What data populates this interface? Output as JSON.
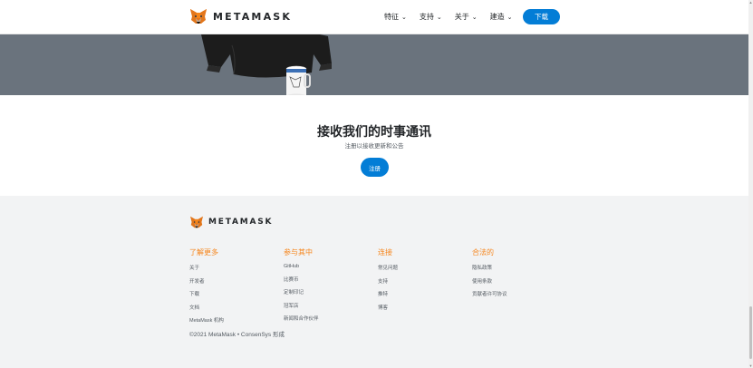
{
  "nav": {
    "brand_name": "METAMASK",
    "items": [
      {
        "label": "特征",
        "icon": "chevron-down-icon"
      },
      {
        "label": "支持",
        "icon": "chevron-down-icon"
      },
      {
        "label": "关于",
        "icon": "chevron-down-icon"
      },
      {
        "label": "建造",
        "icon": "chevron-down-icon"
      }
    ],
    "download_label": "下载"
  },
  "hero": {
    "background_color": "#6a737d",
    "image": "metamask-merch-hoodie-and-mug"
  },
  "newsletter": {
    "title": "接收我们的时事通讯",
    "subtitle": "注册以接收更新和公告",
    "signup_label": "注册"
  },
  "footer": {
    "brand_name": "METAMASK",
    "columns": [
      {
        "heading": "了解更多",
        "links": [
          "关于",
          "开发者",
          "下载",
          "文档",
          "MetaMask 机构"
        ]
      },
      {
        "heading": "参与其中",
        "links": [
          "GitHub",
          "比赛币",
          "定制印记",
          "冠军店",
          "新闻和合作伙伴"
        ]
      },
      {
        "heading": "连接",
        "links": [
          "常见问题",
          "支持",
          "推特",
          "博客"
        ]
      },
      {
        "heading": "合法的",
        "links": [
          "隐私政策",
          "使用条款",
          "贡献者许可协议"
        ]
      }
    ],
    "copyright": "©2021 MetaMask • ConsenSys 形成"
  },
  "colors": {
    "accent": "#037dd6",
    "heading_orange": "#f6851b",
    "footer_bg": "#f2f3f4"
  }
}
